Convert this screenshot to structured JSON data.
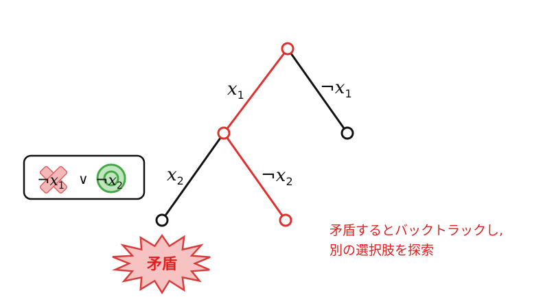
{
  "tree": {
    "edge_labels": {
      "root_left": {
        "var": "x",
        "sub": "1",
        "neg": false
      },
      "root_right": {
        "var": "x",
        "sub": "1",
        "neg": true
      },
      "mid_left": {
        "var": "x",
        "sub": "2",
        "neg": false
      },
      "mid_right": {
        "var": "x",
        "sub": "2",
        "neg": true
      }
    },
    "highlight_color": "#e0302e",
    "default_color": "#111111"
  },
  "clause": {
    "lit1": {
      "neg": true,
      "var": "x",
      "sub": "1",
      "mark": "cross"
    },
    "op": "∨",
    "lit2": {
      "neg": true,
      "var": "x",
      "sub": "2",
      "mark": "circle"
    }
  },
  "conflict_label": "矛盾",
  "note": {
    "line1": "矛盾するとバックトラックし,",
    "line2": "別の選択肢を探索",
    "color": "#e02020"
  },
  "colors": {
    "burst_fill": "#f7c2c2",
    "burst_stroke": "#d93a3a",
    "cross_fill": "#f3b8b8",
    "cross_stroke": "#e06060",
    "circle_fill": "#bfe6bf",
    "circle_stroke": "#45a845"
  }
}
